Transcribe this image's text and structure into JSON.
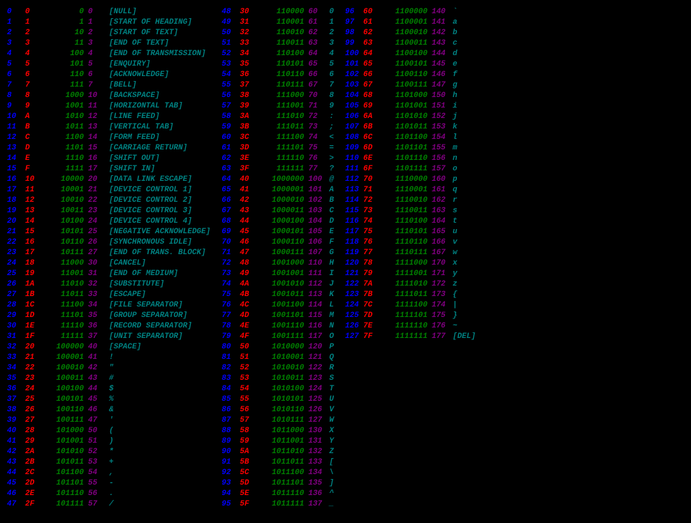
{
  "descriptions": [
    "[NULL]",
    "[START OF HEADING]",
    "[START OF TEXT]",
    "[END OF TEXT]",
    "[END OF TRANSMISSION]",
    "[ENQUIRY]",
    "[ACKNOWLEDGE]",
    "[BELL]",
    "[BACKSPACE]",
    "[HORIZONTAL TAB]",
    "[LINE FEED]",
    "[VERTICAL TAB]",
    "[FORM FEED]",
    "[CARRIAGE RETURN]",
    "[SHIFT OUT]",
    "[SHIFT IN]",
    "[DATA LINK ESCAPE]",
    "[DEVICE CONTROL 1]",
    "[DEVICE CONTROL 2]",
    "[DEVICE CONTROL 3]",
    "[DEVICE CONTROL 4]",
    "[NEGATIVE ACKNOWLEDGE]",
    "[SYNCHRONOUS IDLE]",
    "[END OF TRANS. BLOCK]",
    "[CANCEL]",
    "[END OF MEDIUM]",
    "[SUBSTITUTE]",
    "[ESCAPE]",
    "[FILE SEPARATOR]",
    "[GROUP SEPARATOR]",
    "[RECORD SEPARATOR]",
    "[UNIT SEPARATOR]",
    "[SPACE]",
    "!",
    "\"",
    "#",
    "$",
    "%",
    "&",
    "'",
    "(",
    ")",
    "*",
    "+",
    ",",
    "-",
    ".",
    "/",
    "0",
    "1",
    "2",
    "3",
    "4",
    "5",
    "6",
    "7",
    "8",
    "9",
    ":",
    ";",
    "<",
    "=",
    ">",
    "?",
    "@",
    "A",
    "B",
    "C",
    "D",
    "E",
    "F",
    "G",
    "H",
    "I",
    "J",
    "K",
    "L",
    "M",
    "N",
    "O",
    "P",
    "Q",
    "R",
    "S",
    "T",
    "U",
    "V",
    "W",
    "X",
    "Y",
    "Z",
    "[",
    "\\",
    "]",
    "^",
    "_",
    "`",
    "a",
    "b",
    "c",
    "d",
    "e",
    "f",
    "g",
    "h",
    "i",
    "j",
    "k",
    "l",
    "m",
    "n",
    "o",
    "p",
    "q",
    "r",
    "s",
    "t",
    "u",
    "v",
    "w",
    "x",
    "y",
    "z",
    "{",
    "|",
    "}",
    "~",
    "[DEL]"
  ],
  "column_starts": [
    0,
    48,
    96
  ],
  "column_lengths": [
    48,
    48,
    32
  ]
}
